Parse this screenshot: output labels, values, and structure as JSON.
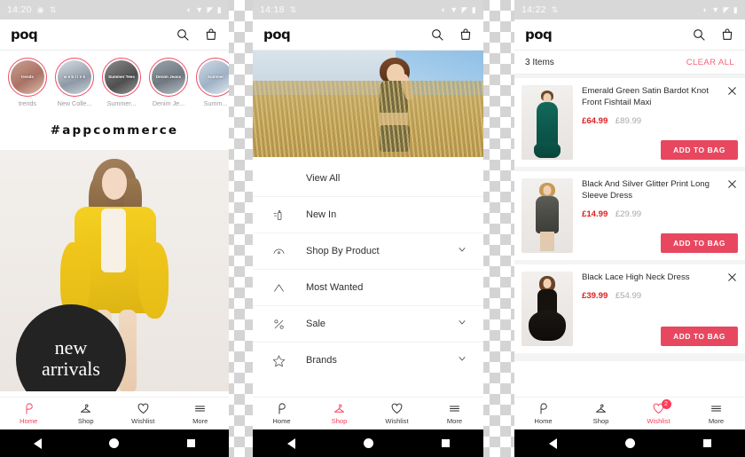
{
  "theme": {
    "accent_pink": "#fa3c5a",
    "button_red": "#e8485f",
    "price_red": "#e02020",
    "clear_all_pink": "#f2657c",
    "story_ring": "#ef4a63"
  },
  "phones": [
    {
      "id": "home",
      "status_bar": {
        "time": "14:20",
        "icons": [
          "cast-icon",
          "sync-icon",
          "dnd-icon",
          "wifi-icon",
          "signal-icon",
          "battery-icon"
        ]
      },
      "app_bar": {
        "logo": "poq",
        "actions": [
          "search-icon",
          "bag-icon"
        ]
      },
      "stories": [
        {
          "label": "trends",
          "caption": "trends"
        },
        {
          "label": "New Colle...",
          "caption": "w e b l i n k"
        },
        {
          "label": "Summer...",
          "caption": "Summer Tees"
        },
        {
          "label": "Denim Je...",
          "caption": "Denim Jeans"
        },
        {
          "label": "Summ...",
          "caption": "Summer"
        }
      ],
      "hashtag": "#appcommerce",
      "hero_badge": {
        "line1": "new",
        "line2": "arrivals"
      },
      "tabs": [
        {
          "label": "Home",
          "icon": "poq-logo-icon",
          "active": true
        },
        {
          "label": "Shop",
          "icon": "hanger-icon",
          "active": false
        },
        {
          "label": "Wishlist",
          "icon": "heart-icon",
          "active": false
        },
        {
          "label": "More",
          "icon": "hamburger-icon",
          "active": false
        }
      ]
    },
    {
      "id": "shop-menu",
      "status_bar": {
        "time": "14:18",
        "icons": [
          "sync-icon",
          "dnd-icon",
          "wifi-icon",
          "signal-icon",
          "battery-icon"
        ]
      },
      "app_bar": {
        "logo": "poq",
        "actions": [
          "search-icon",
          "bag-icon"
        ]
      },
      "menu": [
        {
          "label": "View All",
          "icon": null,
          "chevron": false
        },
        {
          "label": "New In",
          "icon": "new-in-icon",
          "chevron": false
        },
        {
          "label": "Shop By Product",
          "icon": "hanger-arc-icon",
          "chevron": true
        },
        {
          "label": "Most Wanted",
          "icon": "chevron-up-icon",
          "chevron": false
        },
        {
          "label": "Sale",
          "icon": "percent-icon",
          "chevron": true
        },
        {
          "label": "Brands",
          "icon": "star-icon",
          "chevron": true
        }
      ],
      "tabs": [
        {
          "label": "Home",
          "icon": "poq-logo-icon",
          "active": false
        },
        {
          "label": "Shop",
          "icon": "hanger-icon",
          "active": true
        },
        {
          "label": "Wishlist",
          "icon": "heart-icon",
          "active": false
        },
        {
          "label": "More",
          "icon": "hamburger-icon",
          "active": false
        }
      ]
    },
    {
      "id": "wishlist",
      "status_bar": {
        "time": "14:22",
        "icons": [
          "sync-icon",
          "dnd-icon",
          "wifi-icon",
          "signal-icon",
          "battery-icon"
        ]
      },
      "app_bar": {
        "logo": "poq",
        "actions": [
          "search-icon",
          "bag-icon"
        ]
      },
      "cart_header": {
        "count_label": "3 Items",
        "clear_label": "CLEAR ALL"
      },
      "items": [
        {
          "title": "Emerald Green Satin Bardot Knot Front Fishtail Maxi",
          "price_now": "£64.99",
          "price_was": "£89.99",
          "button": "ADD TO BAG",
          "thumb": "emerald-green-maxi-dress"
        },
        {
          "title": "Black And Silver Glitter Print Long Sleeve Dress",
          "price_now": "£14.99",
          "price_was": "£29.99",
          "button": "ADD TO BAG",
          "thumb": "black-silver-glitter-dress"
        },
        {
          "title": "Black Lace High Neck Dress",
          "price_now": "£39.99",
          "price_was": "£54.99",
          "button": "ADD TO BAG",
          "thumb": "black-lace-high-neck-dress"
        }
      ],
      "tabs": [
        {
          "label": "Home",
          "icon": "poq-logo-icon",
          "active": false
        },
        {
          "label": "Shop",
          "icon": "hanger-icon",
          "active": false
        },
        {
          "label": "Wishlist",
          "icon": "heart-icon",
          "active": true,
          "badge": "2"
        },
        {
          "label": "More",
          "icon": "hamburger-icon",
          "active": false
        }
      ]
    }
  ],
  "android_nav": {
    "back": "back-triangle-icon",
    "home": "home-circle-icon",
    "recents": "recents-square-icon"
  }
}
